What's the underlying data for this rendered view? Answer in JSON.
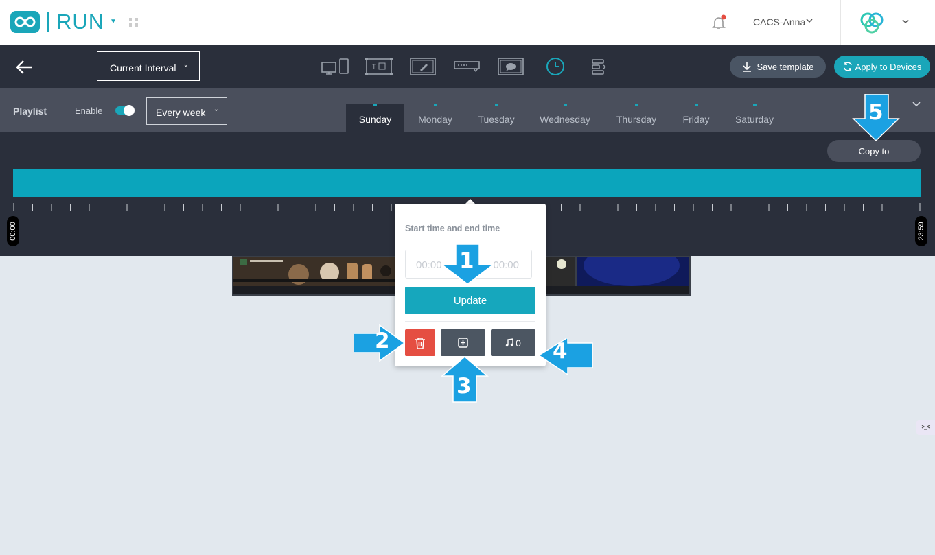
{
  "header": {
    "app_name": "RUN",
    "user_name": "CACS-Anna"
  },
  "toolbar": {
    "interval_label": "Current Interval",
    "icons": [
      "devices-icon",
      "layout-icon",
      "edit-screen-icon",
      "ticker-icon",
      "message-icon",
      "clock-icon",
      "align-icon"
    ],
    "save_template": "Save template",
    "apply_devices": "Apply to Devices"
  },
  "playlist": {
    "title": "Playlist",
    "enable_label": "Enable",
    "enabled": true,
    "repeat": "Every week",
    "days": [
      "Sunday",
      "Monday",
      "Tuesday",
      "Wednesday",
      "Thursday",
      "Friday",
      "Saturday"
    ],
    "active_day": "Sunday"
  },
  "timeline": {
    "copy_to": "Copy to",
    "start": "00:00",
    "end": "23:59"
  },
  "popup": {
    "title": "Start time and end time",
    "start_value": "00:00",
    "end_value": "00:00",
    "update_label": "Update",
    "music_count": "0"
  },
  "callouts": [
    "1",
    "2",
    "3",
    "4",
    "5"
  ],
  "colors": {
    "accent": "#1aa6b9",
    "dark": "#2a2f3b",
    "delete": "#e54e42",
    "callout": "#1ba1e2"
  }
}
